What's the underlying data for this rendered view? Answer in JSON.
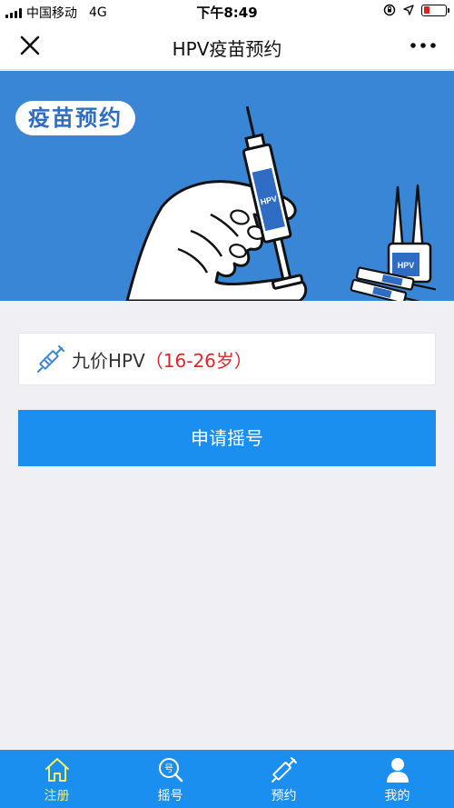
{
  "status_bar": {
    "carrier": "中国移动",
    "network": "4G",
    "time": "下午8:49"
  },
  "nav": {
    "title": "HPV疫苗预约",
    "close_icon": "close-icon",
    "more_icon": "more-icon"
  },
  "banner": {
    "pill_text": "疫苗预约",
    "syringe_label": "HPV",
    "vial_label": "HPV"
  },
  "vaccine": {
    "name": "九价HPV",
    "age_range": "（16-26岁）",
    "icon": "syringe-icon"
  },
  "apply_button": {
    "label": "申请摇号"
  },
  "tabs": [
    {
      "label": "注册",
      "icon": "home-icon",
      "active": true
    },
    {
      "label": "摇号",
      "icon": "lottery-icon",
      "active": false
    },
    {
      "label": "预约",
      "icon": "syringe-icon",
      "active": false
    },
    {
      "label": "我的",
      "icon": "person-icon",
      "active": false
    }
  ],
  "colors": {
    "primary": "#1a8ff0",
    "banner": "#3a86d6",
    "active_tab": "#f3f06a",
    "age_red": "#e0272a"
  }
}
